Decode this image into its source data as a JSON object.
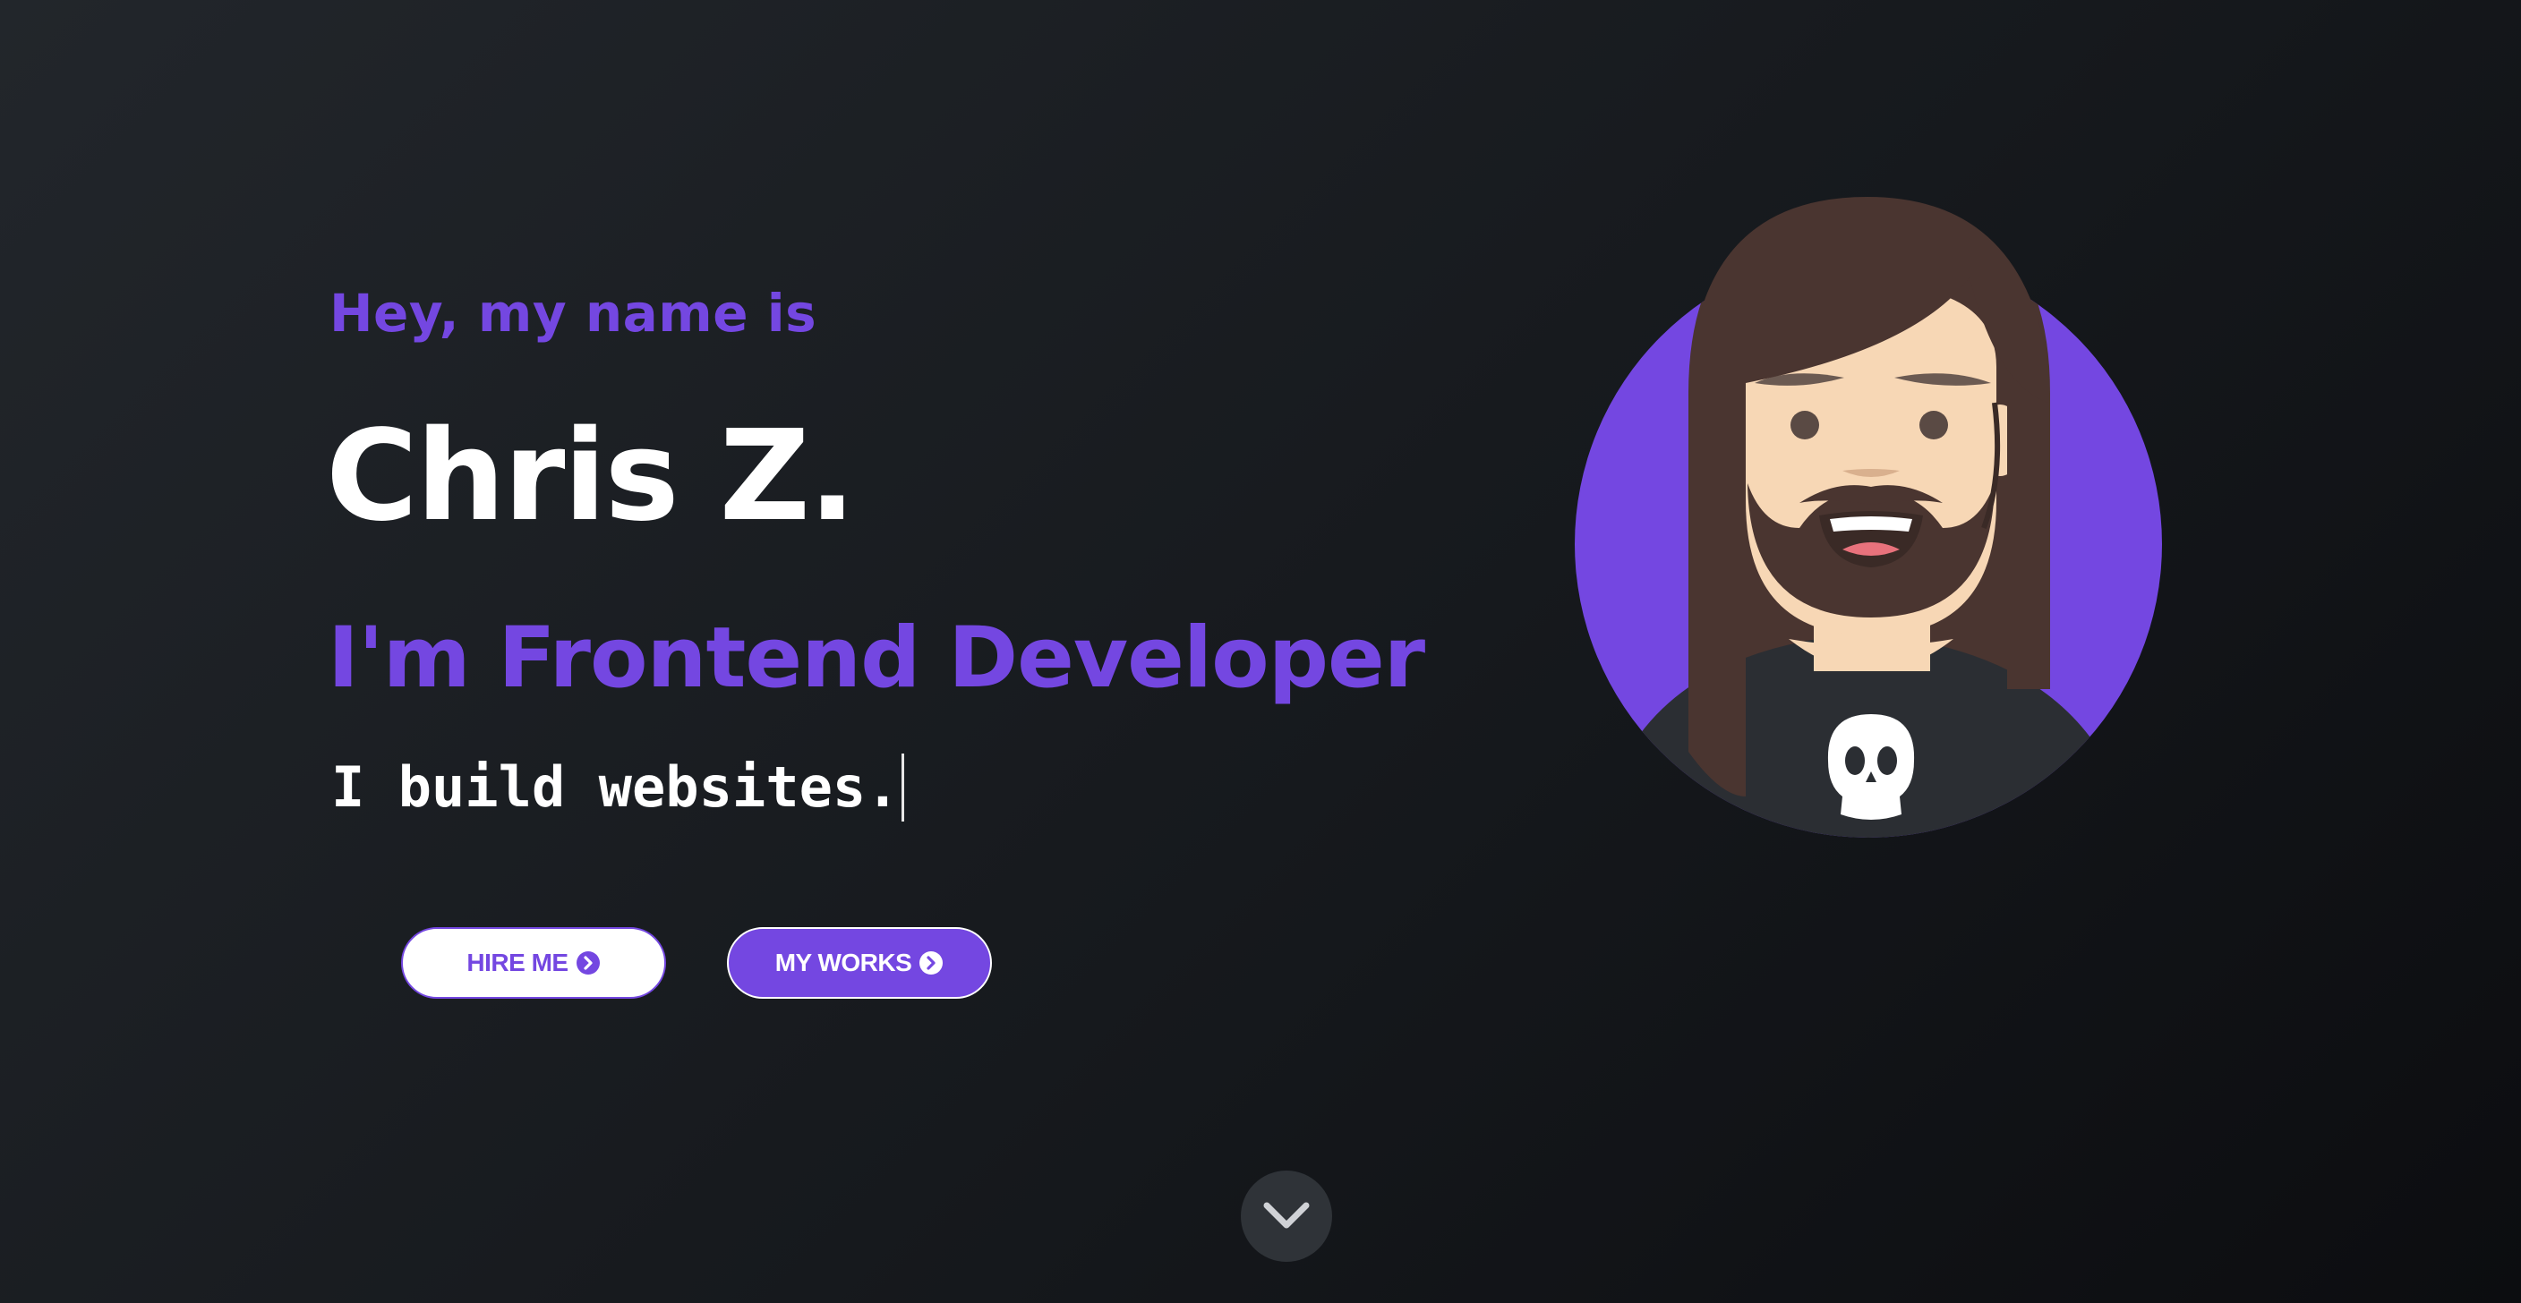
{
  "hero": {
    "intro": "Hey, my name is",
    "name": "Chris Z.",
    "role": "I'm Frontend Developer",
    "typing_text": "I build websites."
  },
  "buttons": {
    "hire_label": "HIRE ME",
    "works_label": "MY WORKS"
  },
  "icons": {
    "button_arrow": "chevron-right-circle-icon",
    "scroll": "chevron-down-icon"
  },
  "colors": {
    "accent": "#7447e1",
    "text": "#ffffff",
    "background_dark": "#16191d",
    "scroll_button": "#2f3338"
  }
}
